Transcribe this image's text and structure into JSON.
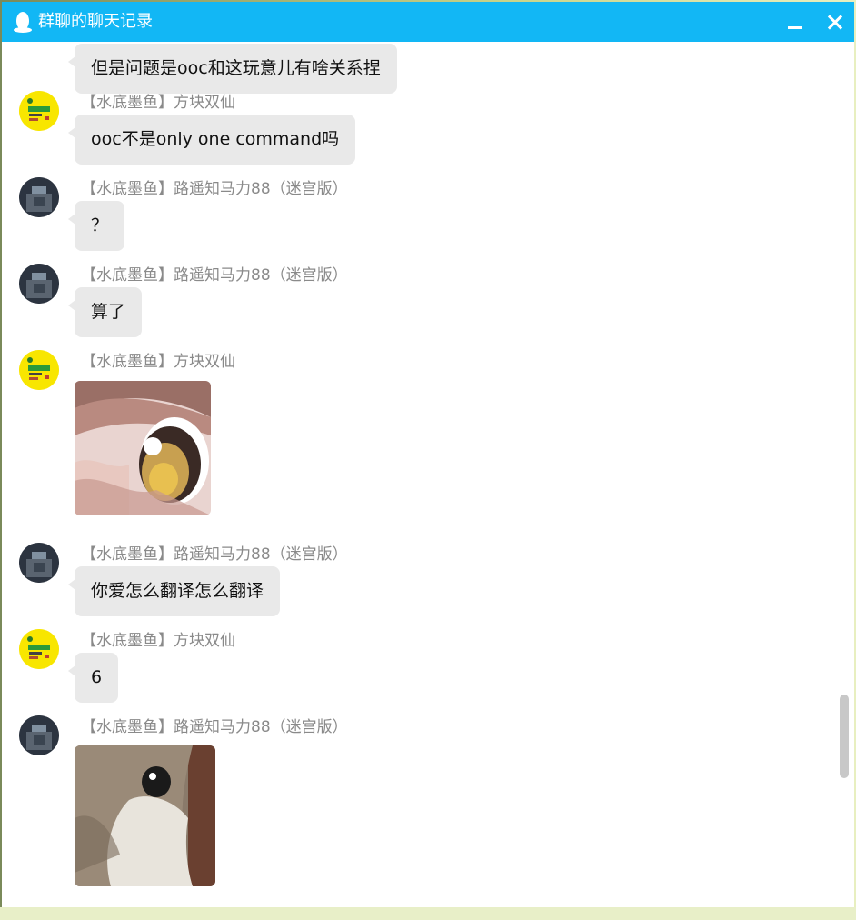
{
  "window": {
    "title": "群聊的聊天记录"
  },
  "messages": [
    {
      "sender": "",
      "text": "但是问题是ooc和这玩意儿有啥关系捏",
      "avatar": "none"
    },
    {
      "sender": "【水底墨鱼】方块双仙",
      "text": "ooc不是only one command吗",
      "avatar": "yellow"
    },
    {
      "sender": "【水底墨鱼】路遥知马力88（迷宫版）",
      "text": "？",
      "avatar": "dark"
    },
    {
      "sender": "【水底墨鱼】路遥知马力88（迷宫版）",
      "text": "算了",
      "avatar": "dark"
    },
    {
      "sender": "【水底墨鱼】方块双仙",
      "image": "anime-eye-sticker",
      "avatar": "yellow"
    },
    {
      "sender": "【水底墨鱼】路遥知马力88（迷宫版）",
      "text": "你爱怎么翻译怎么翻译",
      "avatar": "dark"
    },
    {
      "sender": "【水底墨鱼】方块双仙",
      "text": "6",
      "avatar": "yellow"
    },
    {
      "sender": "【水底墨鱼】路遥知马力88（迷宫版）",
      "image": "cat-eye-sticker",
      "avatar": "dark"
    }
  ],
  "colors": {
    "titlebar": "#12b7f5",
    "bubble": "#e9e9e9",
    "sender": "#8a8a8a"
  }
}
